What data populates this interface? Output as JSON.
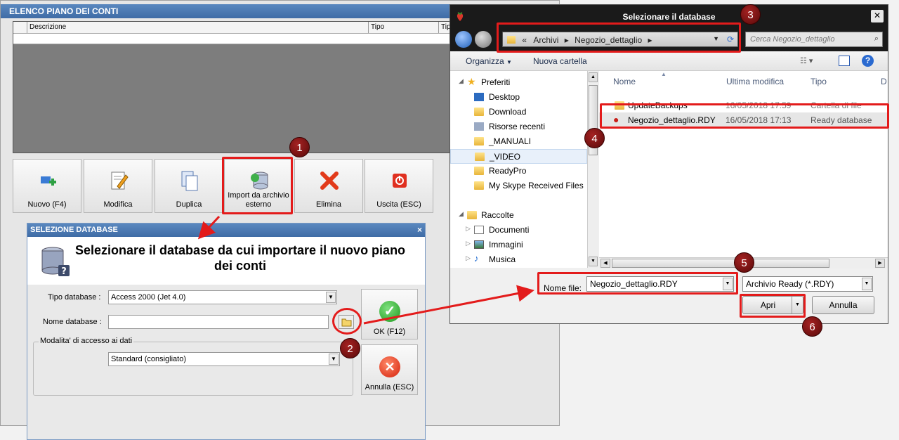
{
  "main": {
    "title": "ELENCO PIANO DEI CONTI",
    "columns": [
      "Descrizione",
      "Tipo",
      "Tip"
    ],
    "toolbar": [
      {
        "label": "Nuovo (F4)",
        "icon": "add-icon"
      },
      {
        "label": "Modifica",
        "icon": "edit-icon"
      },
      {
        "label": "Duplica",
        "icon": "duplicate-icon"
      },
      {
        "label": "Import da archivio esterno",
        "icon": "database-import-icon"
      },
      {
        "label": "Elimina",
        "icon": "delete-icon"
      },
      {
        "label": "Uscita (ESC)",
        "icon": "exit-icon"
      }
    ]
  },
  "selection_dialog": {
    "title": "SELEZIONE DATABASE",
    "close": "×",
    "heading": "Selezionare il database da cui importare il nuovo piano dei conti",
    "tipo_label": "Tipo database :",
    "tipo_value": "Access 2000 (Jet 4.0)",
    "nome_label": "Nome database :",
    "nome_value": "",
    "access_group": "Modalita' di accesso ai dati",
    "access_value": "Standard (consigliato)",
    "ok_label": "OK (F12)",
    "cancel_label": "Annulla (ESC)"
  },
  "file_dialog": {
    "title": "Selezionare il database",
    "close": "✕",
    "path": [
      "Archivi",
      "Negozio_dettaglio"
    ],
    "path_prefix": "«",
    "search_placeholder": "Cerca Negozio_dettaglio",
    "organize": "Organizza",
    "new_folder": "Nuova cartella",
    "nav_sections": [
      {
        "label": "Preferiti",
        "items": [
          "Desktop",
          "Download",
          "Risorse recenti",
          "_MANUALI",
          "_VIDEO",
          "ReadyPro",
          "My Skype Received Files"
        ]
      },
      {
        "label": "Raccolte",
        "items": [
          "Documenti",
          "Immagini",
          "Musica"
        ]
      }
    ],
    "columns": [
      "Nome",
      "Ultima modifica",
      "Tipo",
      "D"
    ],
    "files": [
      {
        "name": "UpdateBackups",
        "modified": "16/05/2018 17:59",
        "type": "Cartella di file"
      },
      {
        "name": "Negozio_dettaglio.RDY",
        "modified": "16/05/2018 17:13",
        "type": "Ready database"
      }
    ],
    "filename_label": "Nome file:",
    "filename_value": "Negozio_dettaglio.RDY",
    "filetype_value": "Archivio Ready (*.RDY)",
    "open_label": "Apri",
    "cancel_label": "Annulla"
  },
  "annotations": [
    "1",
    "2",
    "3",
    "4",
    "5",
    "6"
  ],
  "colors": {
    "highlight": "#e31b1b",
    "badge": "#7a1010",
    "titlebar": "#4a78b2"
  }
}
